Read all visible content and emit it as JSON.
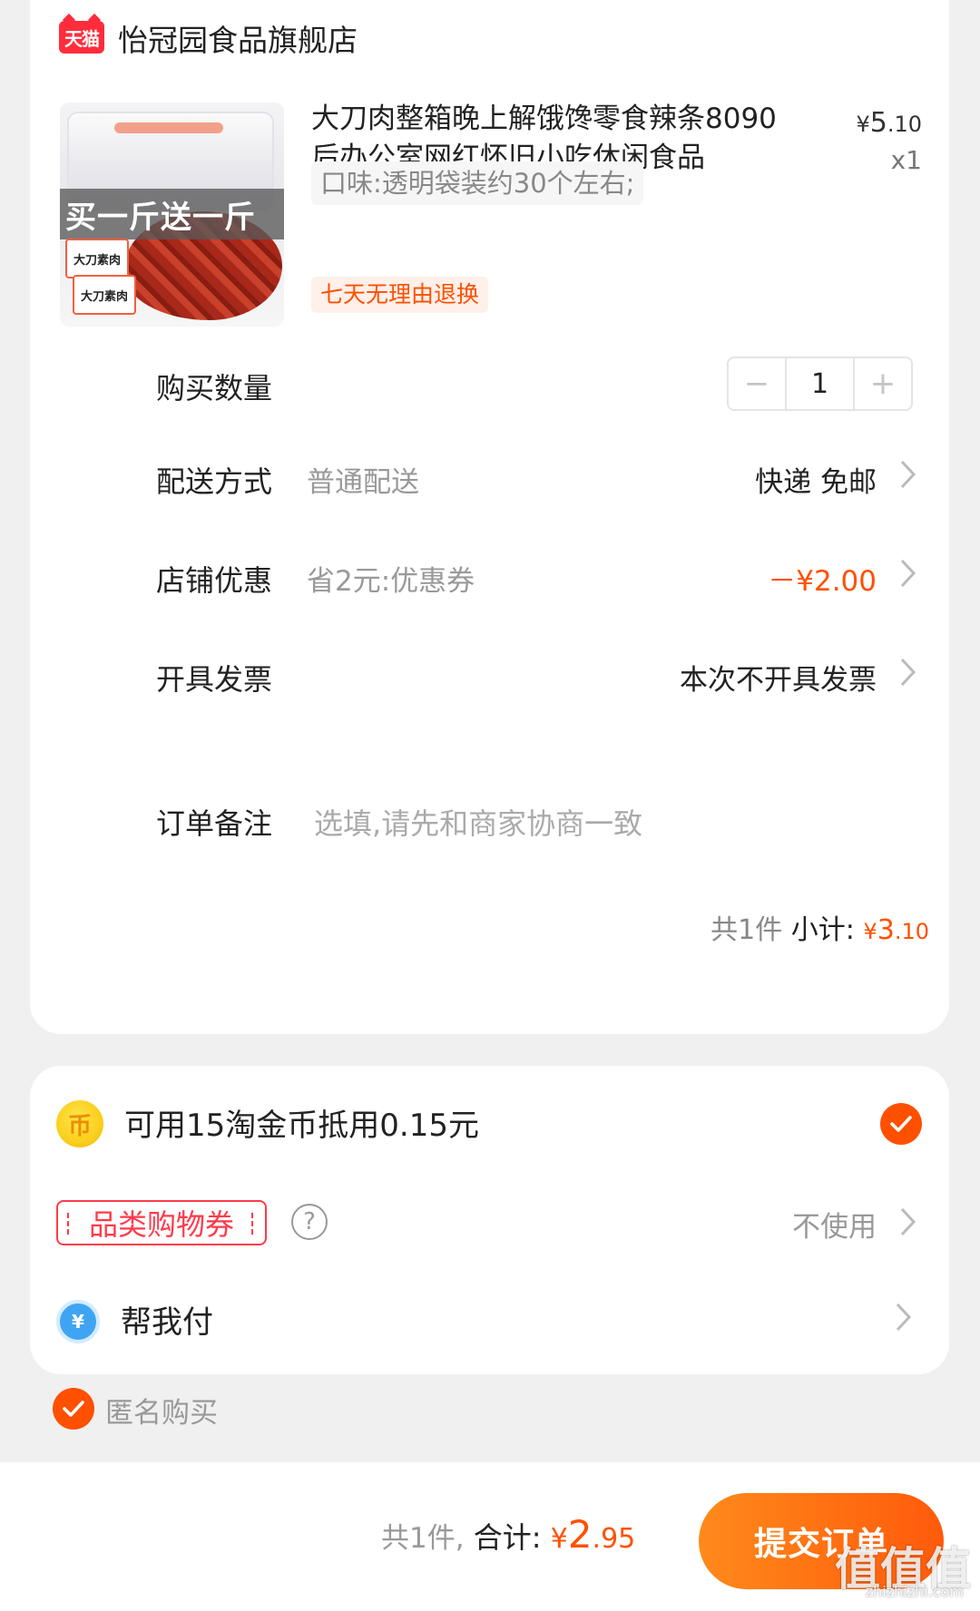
{
  "store": {
    "badge": "天猫",
    "name": "怡冠园食品旗舰店"
  },
  "product": {
    "image_banner": "买一斤送一斤",
    "image_pack_label": "大刀素肉",
    "title": "大刀肉整箱晚上解饿馋零食辣条8090后办公室网红怀旧小吃休闲食品",
    "price_symbol": "¥",
    "price_int": "5",
    "price_dec": ".10",
    "quantity_label": "x1",
    "variant": "口味:透明袋装约30个左右;",
    "return_policy": "七天无理由退换"
  },
  "rows": {
    "quantity": {
      "label": "购买数量",
      "minus": "−",
      "value": "1",
      "plus": "+"
    },
    "delivery": {
      "label": "配送方式",
      "sub": "普通配送",
      "value": "快递 免邮"
    },
    "store_discount": {
      "label": "店铺优惠",
      "sub": "省2元:优惠券",
      "value": "－¥2.00"
    },
    "invoice": {
      "label": "开具发票",
      "value": "本次不开具发票"
    },
    "remark": {
      "label": "订单备注",
      "placeholder": "选填,请先和商家协商一致"
    }
  },
  "subtotal": {
    "count": "共1件",
    "label": "小计:",
    "yen": "¥",
    "int": "3",
    "dec": ".10"
  },
  "options": {
    "coin_icon": "币",
    "coins": "可用15淘金币抵用0.15元",
    "coins_checked": true,
    "coupon_label": "品类购物券",
    "coupon_help": "?",
    "coupon_value": "不使用",
    "pay_icon": "¥",
    "pay_for_me": "帮我付"
  },
  "anonymous": {
    "label": "匿名购买",
    "checked": true
  },
  "footer": {
    "count": "共1件,",
    "total_label": "合计:",
    "yen": "¥",
    "int": "2",
    "dec": ".95",
    "submit": "提交订单"
  },
  "watermark": {
    "main": "值值值",
    "sub": "zhizhizhi.com"
  },
  "colors": {
    "accent": "#ff5000",
    "tmall_red": "#ff2d3c",
    "coupon_red": "#ff3b4b",
    "background": "#f0f0f0"
  }
}
